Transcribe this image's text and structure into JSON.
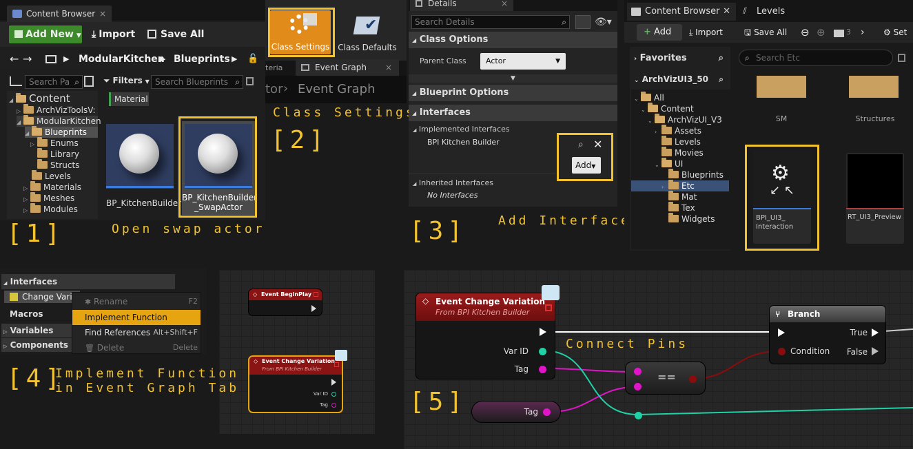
{
  "steps": {
    "s1": {
      "num": "[1]",
      "caption": "Open swap actor"
    },
    "s2": {
      "num": "[2]",
      "caption": "Class Settings"
    },
    "s3": {
      "num": "[3]",
      "caption": "Add Interface"
    },
    "s4": {
      "num": "[4]",
      "caption1": "Implement Function",
      "caption2": "in Event Graph Tab"
    },
    "s5": {
      "num": "[5]",
      "caption": "Connect Pins"
    }
  },
  "cb1": {
    "tab": "Content Browser",
    "add_new": "Add New",
    "import": "Import",
    "save_all": "Save All",
    "path1": "ModularKitchen",
    "path2": "Blueprints",
    "search_paths_placeholder": "Search Pa",
    "filters": "Filters",
    "search_placeholder": "Search Blueprints",
    "filter_chip": "Material",
    "tree": [
      "Content",
      "ArchVizToolsV:",
      "ModularKitchen",
      "Blueprints",
      "Enums",
      "Library",
      "Structs",
      "Levels",
      "Materials",
      "Meshes",
      "Modules"
    ],
    "assets": [
      {
        "label": "BP_KitchenBuilder"
      },
      {
        "label": "BP_KitchenBuilder _SwapActor"
      }
    ]
  },
  "toolbar2": {
    "class_settings": "Class Settings",
    "class_defaults": "Class Defaults",
    "tab_partial": "teria",
    "tab_event_graph": "Event Graph",
    "breadcrumb_partial": "tor",
    "breadcrumb_event_graph": "Event Graph"
  },
  "details": {
    "tab": "Details",
    "search_placeholder": "Search Details",
    "class_options": "Class Options",
    "parent_class_label": "Parent Class",
    "parent_class_value": "Actor",
    "blueprint_options": "Blueprint Options",
    "interfaces": "Interfaces",
    "implemented_interfaces": "Implemented Interfaces",
    "interface_item": "BPI Kitchen Builder",
    "add": "Add",
    "inherited_interfaces": "Inherited Interfaces",
    "no_interfaces": "No Interfaces"
  },
  "cb2": {
    "tab": "Content Browser",
    "levels_tab": "Levels",
    "add": "Add",
    "import": "Import",
    "save_all": "Save All",
    "path_partial": "3",
    "set_partial": "Set",
    "favorites": "Favorites",
    "project": "ArchVizUI3_50",
    "search_placeholder": "Search Etc",
    "tree": [
      "All",
      "Content",
      "ArchVizUI_V3",
      "Assets",
      "Levels",
      "Movies",
      "UI",
      "Blueprints",
      "Etc",
      "Mat",
      "Tex",
      "Widgets"
    ],
    "folders": [
      {
        "label": "SM"
      },
      {
        "label": "Structures"
      }
    ],
    "assets": [
      {
        "label": "BPI_UI3_ Interaction"
      },
      {
        "label": "RT_UI3_Preview"
      }
    ]
  },
  "mybp": {
    "interfaces": "Interfaces",
    "item": "Change Variati",
    "macros": "Macros",
    "variables": "Variables",
    "components": "Components",
    "menu": [
      {
        "label": "Rename",
        "shortcut": "F2"
      },
      {
        "label": "Implement Function",
        "shortcut": ""
      },
      {
        "label": "Find References",
        "shortcut": "Alt+Shift+F"
      },
      {
        "label": "Delete",
        "shortcut": "Delete"
      }
    ]
  },
  "graph4": {
    "begin_play": "Event BeginPlay",
    "event_title": "Event Change Variation",
    "event_sub": "From BPI Kitchen Builder",
    "var_id": "Var ID",
    "tag": "Tag"
  },
  "graph5": {
    "event_title": "Event Change Variation",
    "event_sub": "From BPI Kitchen Builder",
    "var_id": "Var ID",
    "tag": "Tag",
    "equals": "==",
    "branch": "Branch",
    "true_label": "True",
    "condition": "Condition",
    "false_label": "False",
    "tag_var": "Tag"
  },
  "colors": {
    "highlight": "#f2c230",
    "exec": "#ffffff",
    "int_pin": "#1fd1a5",
    "name_pin": "#e014c8",
    "bool_pin": "#8a0c0c",
    "event_header": "#8a1414"
  }
}
